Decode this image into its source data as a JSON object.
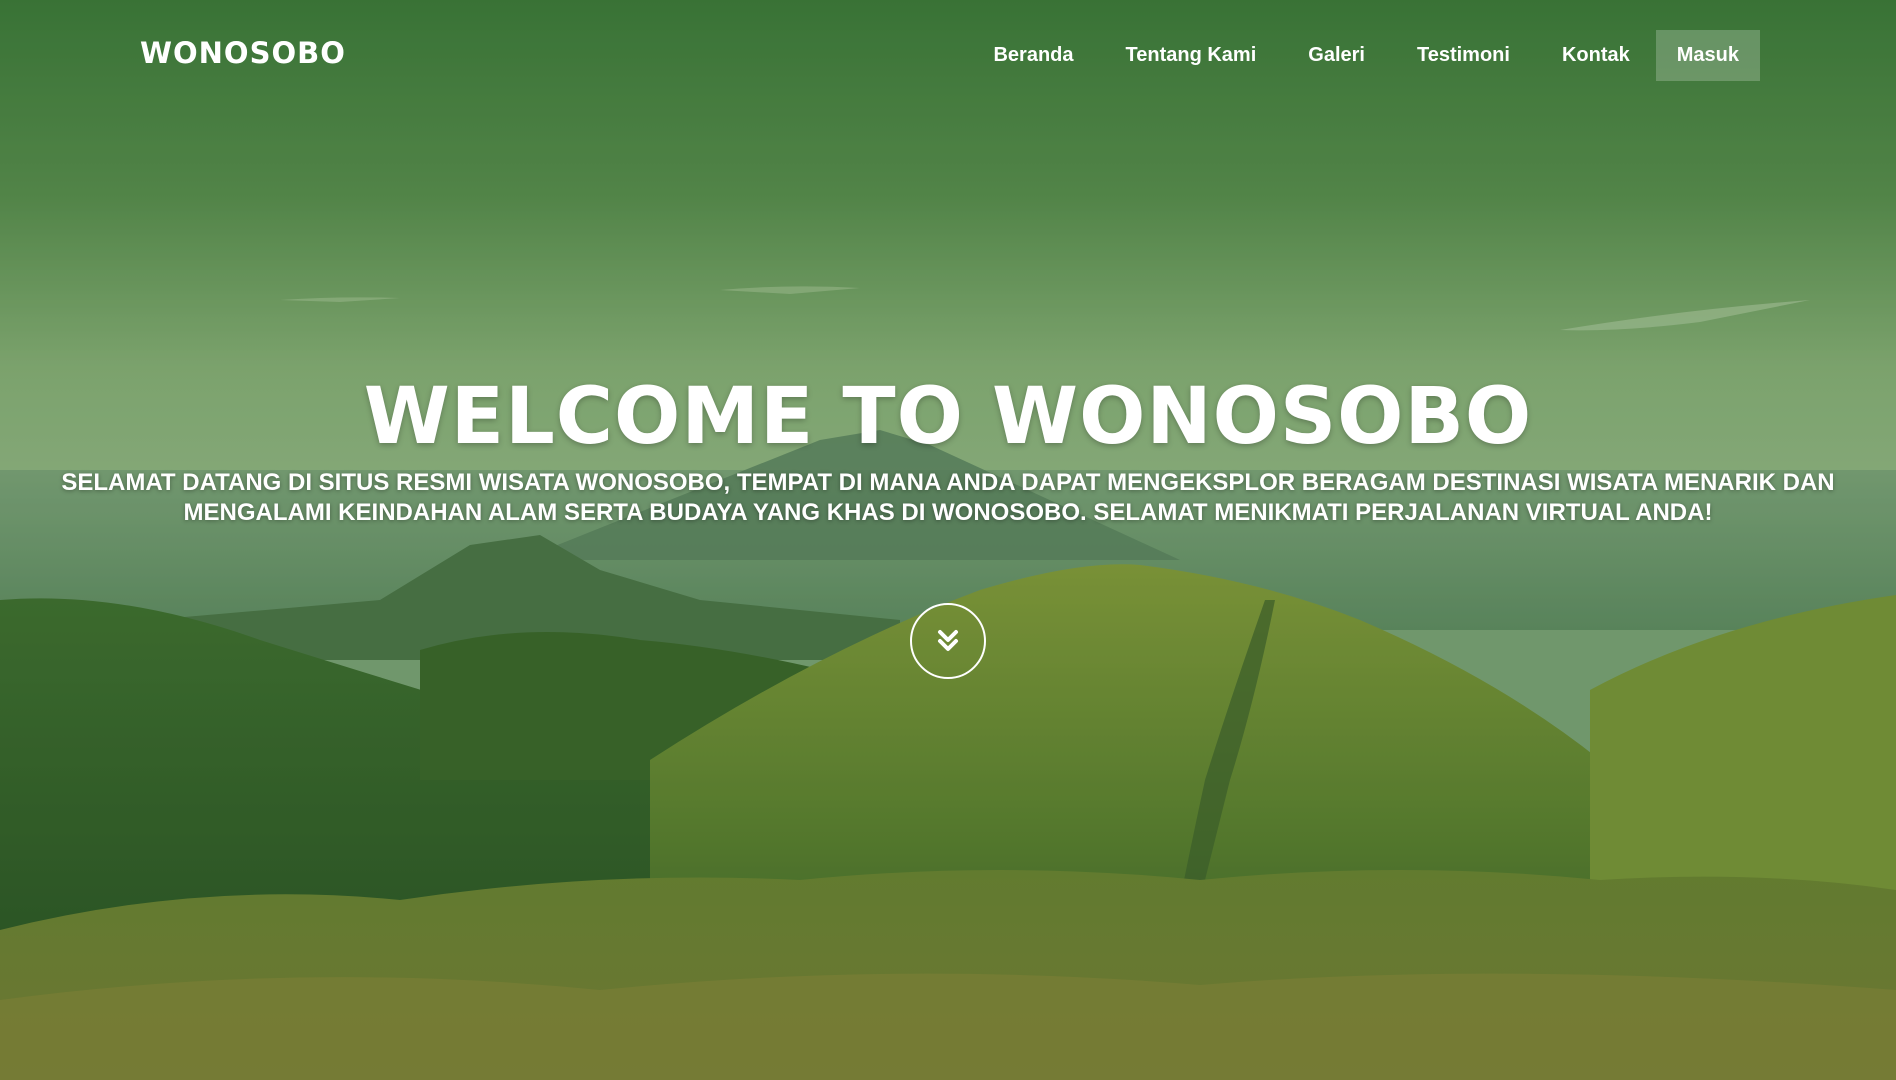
{
  "navbar": {
    "brand": "WONOSOBO",
    "items": [
      {
        "label": "Beranda"
      },
      {
        "label": "Tentang Kami"
      },
      {
        "label": "Galeri"
      },
      {
        "label": "Testimoni"
      },
      {
        "label": "Kontak"
      },
      {
        "label": "Masuk"
      }
    ]
  },
  "hero": {
    "title": "WELCOME TO WONOSOBO",
    "subtitle": "SELAMAT DATANG DI SITUS RESMI WISATA WONOSOBO, TEMPAT DI MANA ANDA DAPAT MENGEKSPLOR BERAGAM DESTINASI WISATA MENARIK DAN MENGALAMI KEINDAHAN ALAM SERTA BUDAYA YANG KHAS DI WONOSOBO. SELAMAT MENIKMATI PERJALANAN VIRTUAL ANDA!",
    "scroll_icon": "double-chevron-down-icon"
  },
  "colors": {
    "overlay": "#3f7a3a",
    "sky_top": "#3c7738",
    "sky_mid": "#8fb07a",
    "hill_light": "#7f9a3c",
    "hill_dark": "#2f5a26",
    "text": "#ffffff"
  }
}
